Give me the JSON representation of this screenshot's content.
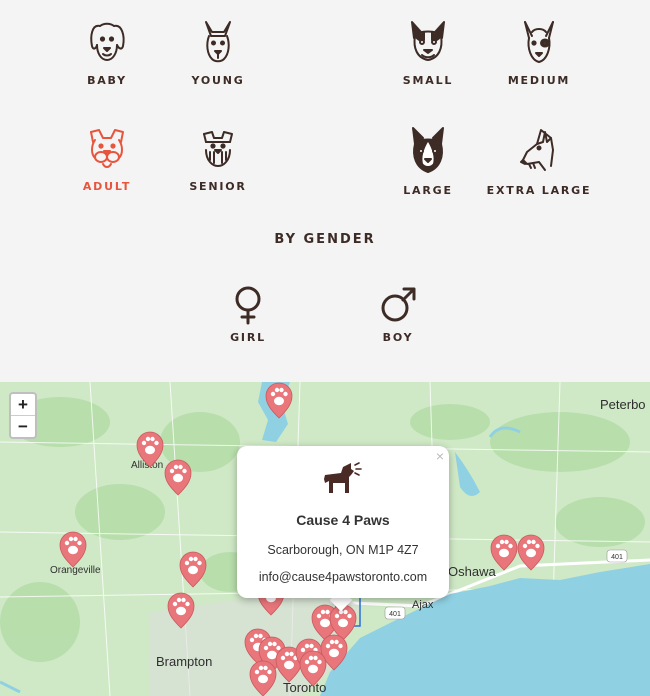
{
  "filters": {
    "age": [
      {
        "label": "BABY",
        "icon": "puppy-icon",
        "active": false
      },
      {
        "label": "YOUNG",
        "icon": "young-dog-icon",
        "active": false
      },
      {
        "label": "ADULT",
        "icon": "adult-dog-icon",
        "active": true
      },
      {
        "label": "SENIOR",
        "icon": "senior-dog-icon",
        "active": false
      }
    ],
    "size": [
      {
        "label": "SMALL",
        "icon": "small-dog-icon"
      },
      {
        "label": "MEDIUM",
        "icon": "medium-dog-icon"
      },
      {
        "label": "LARGE",
        "icon": "large-dog-icon"
      },
      {
        "label": "EXTRA LARGE",
        "icon": "extra-large-dog-icon"
      }
    ],
    "gender_heading": "BY GENDER",
    "gender": [
      {
        "label": "GIRL",
        "icon": "female-symbol-icon"
      },
      {
        "label": "BOY",
        "icon": "male-symbol-icon"
      }
    ]
  },
  "colors": {
    "text": "#3d2b26",
    "active": "#e8553d",
    "marker": "#e8767a",
    "water": "#8fd1e3",
    "land": "#cfe9c6"
  },
  "map": {
    "zoom_in": "+",
    "zoom_out": "−",
    "places": {
      "peterborough": "Peterbo",
      "alliston": "Alliston",
      "orangeville": "Orangeville",
      "oshawa": "Oshawa",
      "ajax": "Ajax",
      "brampton": "Brampton",
      "toronto": "Toronto"
    },
    "road_shields": {
      "r401a": "401",
      "r401b": "401"
    },
    "popup": {
      "close": "×",
      "icon": "barking-dog-icon",
      "name": "Cause 4 Paws",
      "address": "Scarborough, ON M1P 4Z7",
      "email": "info@cause4pawstoronto.com"
    }
  }
}
